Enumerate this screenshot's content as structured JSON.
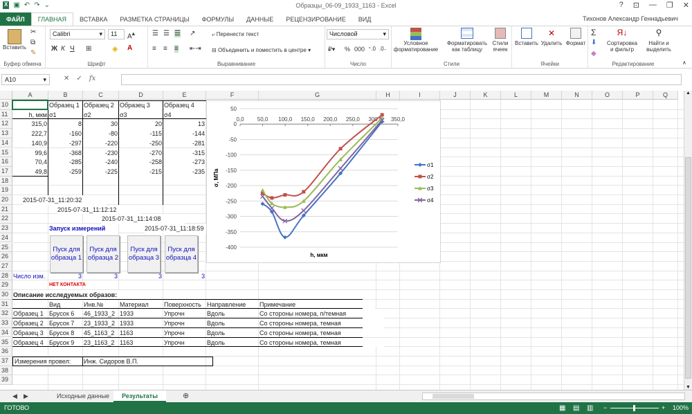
{
  "app": {
    "title": "Образцы_06-09_1933_1163 - Excel",
    "user": "Тихонов Александр Геннадьевич"
  },
  "tabs": [
    "ФАЙЛ",
    "ГЛАВНАЯ",
    "ВСТАВКА",
    "РАЗМЕТКА СТРАНИЦЫ",
    "ФОРМУЛЫ",
    "ДАННЫЕ",
    "РЕЦЕНЗИРОВАНИЕ",
    "ВИД"
  ],
  "ribbon": {
    "paste": "Вставить",
    "clipboard": "Буфер обмена",
    "font_name": "Calibri",
    "font_size": "11",
    "font_group": "Шрифт",
    "wrap_text": "Перенести текст",
    "merge_center": "Объединить и поместить в центре",
    "alignment": "Выравнивание",
    "number_format": "Числовой",
    "number_group": "Число",
    "cond_format_1": "Условное",
    "cond_format_2": "форматирование",
    "format_table_1": "Форматировать",
    "format_table_2": "как таблицу",
    "cell_styles_1": "Стили",
    "cell_styles_2": "ячеек",
    "styles_group": "Стили",
    "insert": "Вставить",
    "delete": "Удалить",
    "format": "Формат",
    "cells_group": "Ячейки",
    "sort_1": "Сортировка",
    "sort_2": "и фильтр",
    "find_1": "Найти и",
    "find_2": "выделить",
    "editing_group": "Редактирование",
    "percent": "%",
    "thousands": "000"
  },
  "formula_bar": {
    "name_box": "A10",
    "formula": "",
    "fx": "fx"
  },
  "columns": [
    "A",
    "B",
    "C",
    "D",
    "E",
    "F",
    "G",
    "H",
    "I",
    "J",
    "K",
    "L",
    "M",
    "N",
    "O",
    "P",
    "Q"
  ],
  "rows": [
    "10",
    "11",
    "12",
    "13",
    "14",
    "15",
    "16",
    "17",
    "18",
    "19",
    "20",
    "21",
    "22",
    "23",
    "24",
    "25",
    "26",
    "27",
    "28",
    "29",
    "30",
    "31",
    "32",
    "33",
    "34",
    "35",
    "36",
    "37",
    "38",
    "39"
  ],
  "table": {
    "headers": [
      "Образец 1",
      "Образец  2",
      "Образец 3",
      "Образец 4"
    ],
    "subheaders": [
      "h, мкм",
      "σ1",
      "σ2",
      "σ3",
      "σ4"
    ],
    "data": [
      [
        "315,0",
        "8",
        "30",
        "20",
        "13"
      ],
      [
        "222,7",
        "-160",
        "-80",
        "-115",
        "-144"
      ],
      [
        "140,9",
        "-297",
        "-220",
        "-250",
        "-281"
      ],
      [
        "99,6",
        "-368",
        "-230",
        "-270",
        "-315"
      ],
      [
        "70,4",
        "-285",
        "-240",
        "-258",
        "-273"
      ],
      [
        "49,8",
        "-259",
        "-225",
        "-215",
        "-235"
      ]
    ]
  },
  "timestamps": [
    "2015-07-31_11:20:32",
    "2015-07-31_11:12:12",
    "2015-07-31_11:14:08",
    "2015-07-31_11:18:59"
  ],
  "launch_label": "Запуск измерений",
  "buttons": [
    "Пуск для образца 1",
    "Пуск для образца 2",
    "Пуск для образца 3",
    "Пуск для образца 4"
  ],
  "count_label": "Число изм.",
  "counts": [
    "3",
    "3",
    "3",
    "3"
  ],
  "no_contact": "НЕТ КОНТАКТА",
  "samples": {
    "title": "Описание исследуемых образов:",
    "headers": [
      "Вид",
      "Инв.№",
      "Материал",
      "Поверхность",
      "Направление",
      "Примечание"
    ],
    "rows": [
      [
        "Образец 1",
        "Брусок 6",
        "46_1933_2",
        "1933",
        "Упрочн",
        "Вдоль",
        "Со стороны номера, п/темная"
      ],
      [
        "Образец 2",
        "Брусок 7",
        "23_1933_2",
        "1933",
        "Упрочн",
        "Вдоль",
        "Со стороны номера, темная"
      ],
      [
        "Образец 3",
        "Брусок 8",
        "45_1163_2",
        "1163",
        "Упрочн",
        "Вдоль",
        "Со стороны номера, темная"
      ],
      [
        "Образец 4",
        "Брусок 9",
        "23_1163_2",
        "1163",
        "Упрочн",
        "Вдоль",
        "Со стороны номера, темная"
      ]
    ]
  },
  "measured_by_label": "Измерения провел:",
  "measured_by": "Инж. Сидоров В.П.",
  "sheet_tabs": [
    "Исходные данные",
    "Результаты"
  ],
  "status": {
    "ready": "ГОТОВО",
    "zoom": "100%"
  },
  "colors": {
    "accent": "#217346",
    "s1": "#4472c4",
    "s2": "#c0504d",
    "s3": "#9bbb59",
    "s4": "#8064a2"
  },
  "chart_data": {
    "type": "line",
    "xlabel": "h, мкм",
    "ylabel": "σ, МПа",
    "xlim": [
      0,
      350
    ],
    "ylim": [
      -400,
      50
    ],
    "xticks": [
      "0,0",
      "50,0",
      "100,0",
      "150,0",
      "200,0",
      "250,0",
      "300,0",
      "350,0"
    ],
    "yticks": [
      "50",
      "0",
      "-50",
      "-100",
      "-150",
      "-200",
      "-250",
      "-300",
      "-350",
      "-400"
    ],
    "x": [
      49.8,
      70.4,
      99.6,
      140.9,
      222.7,
      315.0
    ],
    "series": [
      {
        "name": "σ1",
        "values": [
          -259,
          -285,
          -368,
          -297,
          -160,
          8
        ]
      },
      {
        "name": "σ2",
        "values": [
          -225,
          -240,
          -230,
          -220,
          -80,
          30
        ]
      },
      {
        "name": "σ3",
        "values": [
          -215,
          -258,
          -270,
          -250,
          -115,
          20
        ]
      },
      {
        "name": "σ4",
        "values": [
          -235,
          -273,
          -315,
          -281,
          -144,
          13
        ]
      }
    ],
    "legend": "right",
    "grid": true
  }
}
